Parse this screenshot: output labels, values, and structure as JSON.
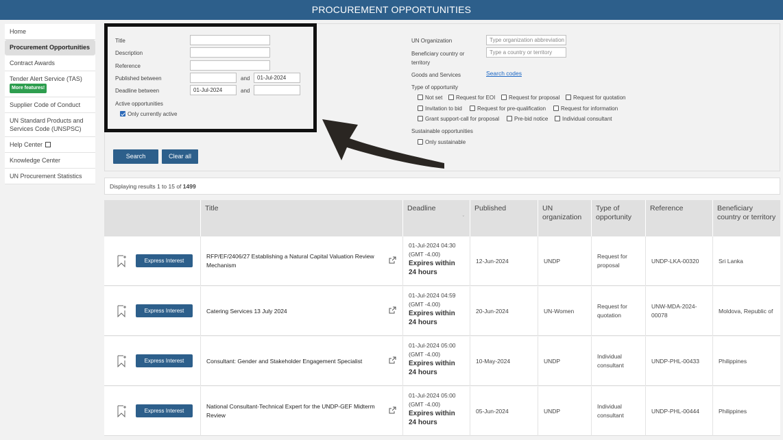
{
  "header": {
    "title": "PROCUREMENT OPPORTUNITIES"
  },
  "sidebar": {
    "items": [
      {
        "label": "Home"
      },
      {
        "label": "Procurement Opportunities",
        "active": true
      },
      {
        "label": "Contract Awards"
      },
      {
        "label": "Tender Alert Service (TAS)",
        "badge": "More features!"
      },
      {
        "label": "Supplier Code of Conduct"
      },
      {
        "label": "UN Standard Products and Services Code (UNSPSC)"
      },
      {
        "label": "Help Center",
        "external": true
      },
      {
        "label": "Knowledge Center"
      },
      {
        "label": "UN Procurement Statistics"
      }
    ]
  },
  "filters": {
    "title_label": "Title",
    "description_label": "Description",
    "reference_label": "Reference",
    "published_label": "Published between",
    "published_to": "01-Jul-2024",
    "deadline_label": "Deadline between",
    "deadline_from": "01-Jul-2024",
    "and_label": "and",
    "active_label": "Active opportunities",
    "only_active_label": "Only currently active",
    "un_org_label": "UN Organization",
    "un_org_placeholder": "Type organization abbreviation",
    "country_label": "Beneficiary country or territory",
    "country_placeholder": "Type a country or territory",
    "goods_label": "Goods and Services",
    "search_codes_label": "Search codes",
    "type_label": "Type of opportunity",
    "types": [
      "Not set",
      "Request for EOI",
      "Request for proposal",
      "Request for quotation",
      "Invitation to bid",
      "Request for pre-qualification",
      "Request for information",
      "Grant support-call for proposal",
      "Pre-bid notice",
      "Individual consultant"
    ],
    "sustainable_label": "Sustainable opportunities",
    "only_sustainable_label": "Only sustainable",
    "search_button": "Search",
    "clear_button": "Clear all"
  },
  "results": {
    "prefix": "Displaying results 1 to 15 of ",
    "total": "1499"
  },
  "table": {
    "columns": [
      "Title",
      "Deadline",
      "Published",
      "UN organization",
      "Type of opportunity",
      "Reference",
      "Beneficiary country or territory"
    ],
    "express_label": "Express Interest",
    "expires_label": "Expires within 24 hours",
    "rows": [
      {
        "title": "RFP/EF/2406/27 Establishing a Natural Capital Valuation Review Mechanism",
        "deadline": "01-Jul-2024 04:30",
        "tz": "(GMT -4.00)",
        "published": "12-Jun-2024",
        "org": "UNDP",
        "type": "Request for proposal",
        "reference": "UNDP-LKA-00320",
        "country": "Sri Lanka"
      },
      {
        "title": "Catering Services 13 July 2024",
        "deadline": "01-Jul-2024 04:59",
        "tz": "(GMT -4.00)",
        "published": "20-Jun-2024",
        "org": "UN-Women",
        "type": "Request for quotation",
        "reference": "UNW-MDA-2024-00078",
        "country": "Moldova, Republic of"
      },
      {
        "title": "Consultant: Gender and Stakeholder Engagement Specialist",
        "deadline": "01-Jul-2024 05:00",
        "tz": "(GMT -4.00)",
        "published": "10-May-2024",
        "org": "UNDP",
        "type": "Individual consultant",
        "reference": "UNDP-PHL-00433",
        "country": "Philippines"
      },
      {
        "title": "National Consultant-Technical Expert for the UNDP-GEF Midterm Review",
        "deadline": "01-Jul-2024 05:00",
        "tz": "(GMT -4.00)",
        "published": "05-Jun-2024",
        "org": "UNDP",
        "type": "Individual consultant",
        "reference": "UNDP-PHL-00444",
        "country": "Philippines"
      }
    ]
  },
  "colors": {
    "brand": "#2d5f8b",
    "badge": "#2e9e4f",
    "link": "#1a66c4"
  }
}
